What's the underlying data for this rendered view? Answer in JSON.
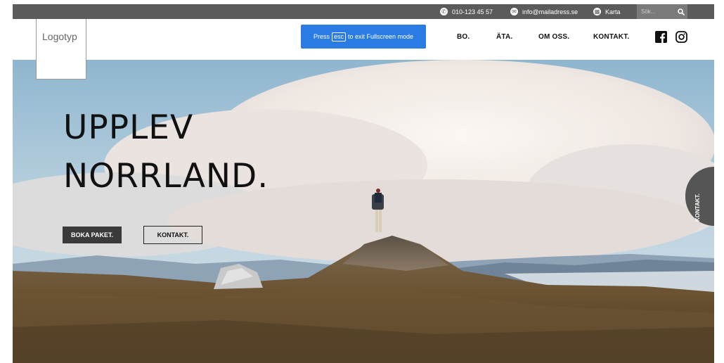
{
  "topbar": {
    "phone": "010-123 45 57",
    "email": "info@mailadress.se",
    "map_label": "Karta",
    "search_placeholder": "Sök..."
  },
  "header": {
    "logo_text": "Logotyp",
    "fullscreen_toast": {
      "prefix": "Press",
      "key": "esc",
      "suffix": "to exit Fullscreen mode"
    },
    "nav": [
      {
        "label": "BO."
      },
      {
        "label": "ÄTA."
      },
      {
        "label": "OM OSS."
      },
      {
        "label": "KONTAKT."
      }
    ],
    "social_icons": [
      "facebook-icon",
      "instagram-icon"
    ]
  },
  "hero": {
    "headline_line1": "UPPLEV",
    "headline_line2": "NORRLAND.",
    "book_button": "BOKA PAKET.",
    "contact_button": "KONTAKT.",
    "side_tab": "KONTAKT."
  },
  "colors": {
    "topbar": "#5b5b5b",
    "toast": "#2b7be4",
    "book_button": "#3a3a3a",
    "side_tab": "#555555"
  }
}
